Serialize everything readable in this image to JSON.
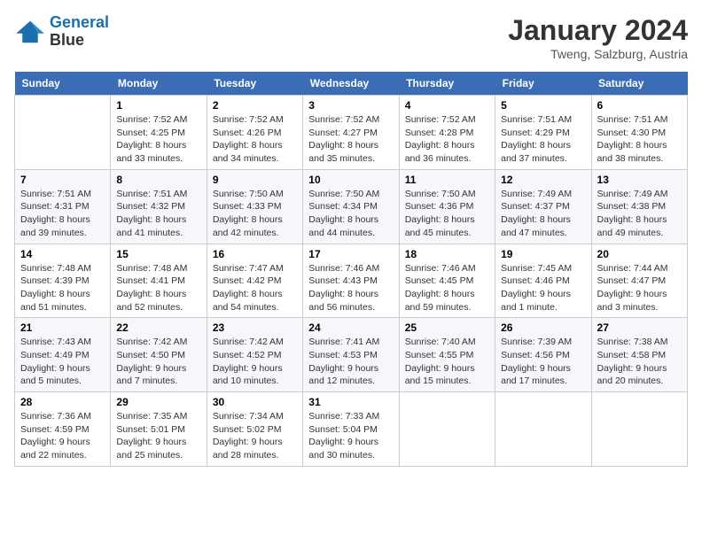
{
  "logo": {
    "line1": "General",
    "line2": "Blue"
  },
  "title": "January 2024",
  "location": "Tweng, Salzburg, Austria",
  "weekdays": [
    "Sunday",
    "Monday",
    "Tuesday",
    "Wednesday",
    "Thursday",
    "Friday",
    "Saturday"
  ],
  "weeks": [
    [
      {
        "day": "",
        "sunrise": "",
        "sunset": "",
        "daylight": ""
      },
      {
        "day": "1",
        "sunrise": "Sunrise: 7:52 AM",
        "sunset": "Sunset: 4:25 PM",
        "daylight": "Daylight: 8 hours and 33 minutes."
      },
      {
        "day": "2",
        "sunrise": "Sunrise: 7:52 AM",
        "sunset": "Sunset: 4:26 PM",
        "daylight": "Daylight: 8 hours and 34 minutes."
      },
      {
        "day": "3",
        "sunrise": "Sunrise: 7:52 AM",
        "sunset": "Sunset: 4:27 PM",
        "daylight": "Daylight: 8 hours and 35 minutes."
      },
      {
        "day": "4",
        "sunrise": "Sunrise: 7:52 AM",
        "sunset": "Sunset: 4:28 PM",
        "daylight": "Daylight: 8 hours and 36 minutes."
      },
      {
        "day": "5",
        "sunrise": "Sunrise: 7:51 AM",
        "sunset": "Sunset: 4:29 PM",
        "daylight": "Daylight: 8 hours and 37 minutes."
      },
      {
        "day": "6",
        "sunrise": "Sunrise: 7:51 AM",
        "sunset": "Sunset: 4:30 PM",
        "daylight": "Daylight: 8 hours and 38 minutes."
      }
    ],
    [
      {
        "day": "7",
        "sunrise": "Sunrise: 7:51 AM",
        "sunset": "Sunset: 4:31 PM",
        "daylight": "Daylight: 8 hours and 39 minutes."
      },
      {
        "day": "8",
        "sunrise": "Sunrise: 7:51 AM",
        "sunset": "Sunset: 4:32 PM",
        "daylight": "Daylight: 8 hours and 41 minutes."
      },
      {
        "day": "9",
        "sunrise": "Sunrise: 7:50 AM",
        "sunset": "Sunset: 4:33 PM",
        "daylight": "Daylight: 8 hours and 42 minutes."
      },
      {
        "day": "10",
        "sunrise": "Sunrise: 7:50 AM",
        "sunset": "Sunset: 4:34 PM",
        "daylight": "Daylight: 8 hours and 44 minutes."
      },
      {
        "day": "11",
        "sunrise": "Sunrise: 7:50 AM",
        "sunset": "Sunset: 4:36 PM",
        "daylight": "Daylight: 8 hours and 45 minutes."
      },
      {
        "day": "12",
        "sunrise": "Sunrise: 7:49 AM",
        "sunset": "Sunset: 4:37 PM",
        "daylight": "Daylight: 8 hours and 47 minutes."
      },
      {
        "day": "13",
        "sunrise": "Sunrise: 7:49 AM",
        "sunset": "Sunset: 4:38 PM",
        "daylight": "Daylight: 8 hours and 49 minutes."
      }
    ],
    [
      {
        "day": "14",
        "sunrise": "Sunrise: 7:48 AM",
        "sunset": "Sunset: 4:39 PM",
        "daylight": "Daylight: 8 hours and 51 minutes."
      },
      {
        "day": "15",
        "sunrise": "Sunrise: 7:48 AM",
        "sunset": "Sunset: 4:41 PM",
        "daylight": "Daylight: 8 hours and 52 minutes."
      },
      {
        "day": "16",
        "sunrise": "Sunrise: 7:47 AM",
        "sunset": "Sunset: 4:42 PM",
        "daylight": "Daylight: 8 hours and 54 minutes."
      },
      {
        "day": "17",
        "sunrise": "Sunrise: 7:46 AM",
        "sunset": "Sunset: 4:43 PM",
        "daylight": "Daylight: 8 hours and 56 minutes."
      },
      {
        "day": "18",
        "sunrise": "Sunrise: 7:46 AM",
        "sunset": "Sunset: 4:45 PM",
        "daylight": "Daylight: 8 hours and 59 minutes."
      },
      {
        "day": "19",
        "sunrise": "Sunrise: 7:45 AM",
        "sunset": "Sunset: 4:46 PM",
        "daylight": "Daylight: 9 hours and 1 minute."
      },
      {
        "day": "20",
        "sunrise": "Sunrise: 7:44 AM",
        "sunset": "Sunset: 4:47 PM",
        "daylight": "Daylight: 9 hours and 3 minutes."
      }
    ],
    [
      {
        "day": "21",
        "sunrise": "Sunrise: 7:43 AM",
        "sunset": "Sunset: 4:49 PM",
        "daylight": "Daylight: 9 hours and 5 minutes."
      },
      {
        "day": "22",
        "sunrise": "Sunrise: 7:42 AM",
        "sunset": "Sunset: 4:50 PM",
        "daylight": "Daylight: 9 hours and 7 minutes."
      },
      {
        "day": "23",
        "sunrise": "Sunrise: 7:42 AM",
        "sunset": "Sunset: 4:52 PM",
        "daylight": "Daylight: 9 hours and 10 minutes."
      },
      {
        "day": "24",
        "sunrise": "Sunrise: 7:41 AM",
        "sunset": "Sunset: 4:53 PM",
        "daylight": "Daylight: 9 hours and 12 minutes."
      },
      {
        "day": "25",
        "sunrise": "Sunrise: 7:40 AM",
        "sunset": "Sunset: 4:55 PM",
        "daylight": "Daylight: 9 hours and 15 minutes."
      },
      {
        "day": "26",
        "sunrise": "Sunrise: 7:39 AM",
        "sunset": "Sunset: 4:56 PM",
        "daylight": "Daylight: 9 hours and 17 minutes."
      },
      {
        "day": "27",
        "sunrise": "Sunrise: 7:38 AM",
        "sunset": "Sunset: 4:58 PM",
        "daylight": "Daylight: 9 hours and 20 minutes."
      }
    ],
    [
      {
        "day": "28",
        "sunrise": "Sunrise: 7:36 AM",
        "sunset": "Sunset: 4:59 PM",
        "daylight": "Daylight: 9 hours and 22 minutes."
      },
      {
        "day": "29",
        "sunrise": "Sunrise: 7:35 AM",
        "sunset": "Sunset: 5:01 PM",
        "daylight": "Daylight: 9 hours and 25 minutes."
      },
      {
        "day": "30",
        "sunrise": "Sunrise: 7:34 AM",
        "sunset": "Sunset: 5:02 PM",
        "daylight": "Daylight: 9 hours and 28 minutes."
      },
      {
        "day": "31",
        "sunrise": "Sunrise: 7:33 AM",
        "sunset": "Sunset: 5:04 PM",
        "daylight": "Daylight: 9 hours and 30 minutes."
      },
      {
        "day": "",
        "sunrise": "",
        "sunset": "",
        "daylight": ""
      },
      {
        "day": "",
        "sunrise": "",
        "sunset": "",
        "daylight": ""
      },
      {
        "day": "",
        "sunrise": "",
        "sunset": "",
        "daylight": ""
      }
    ]
  ]
}
